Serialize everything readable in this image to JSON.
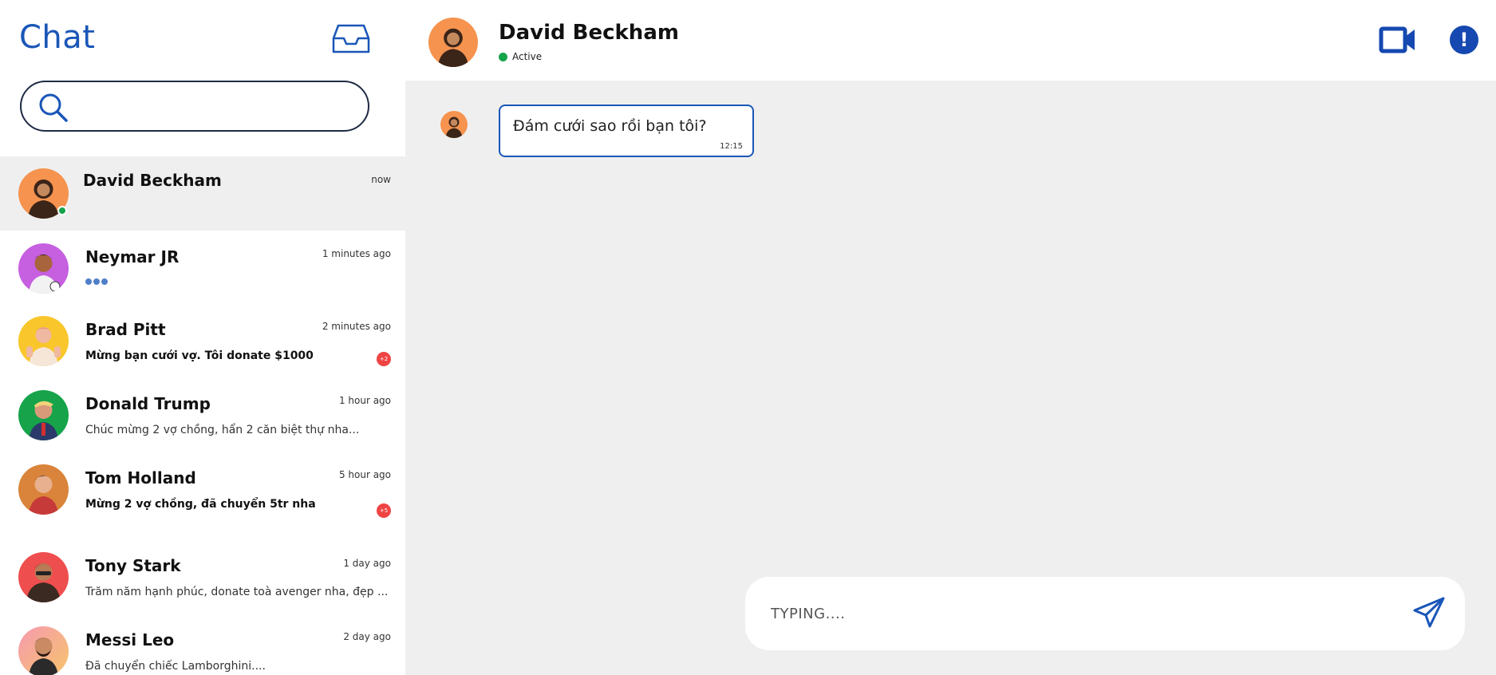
{
  "sidebar": {
    "title": "Chat",
    "search": {
      "placeholder": "",
      "value": ""
    },
    "conversations": [
      {
        "name": "David Beckham",
        "time": "now",
        "preview": "",
        "active": true,
        "online": true,
        "avatar_color": "#f5934f"
      },
      {
        "name": "Neymar JR",
        "time": "1 minutes ago",
        "preview": "",
        "typing": true,
        "avatar_color": "#c65fe0"
      },
      {
        "name": "Brad Pitt",
        "time": "2 minutes ago",
        "preview": "Mừng bạn cưới vợ. Tôi donate $1000",
        "preview_bold": true,
        "badge": "+2",
        "avatar_color": "#f9c62b"
      },
      {
        "name": "Donald Trump",
        "time": "1 hour ago",
        "preview": "Chúc mừng 2 vợ chồng, hẩn 2 căn biệt thự nha...",
        "avatar_color": "#16a34a"
      },
      {
        "name": "Tom Holland",
        "time": "5 hour ago",
        "preview": "Mừng 2 vợ chồng, đã chuyển 5tr nha",
        "preview_bold": true,
        "badge": "+5",
        "avatar_color": "#d9843a"
      },
      {
        "name": "Tony Stark",
        "time": "1 day ago",
        "preview": "Trăm năm hạnh phúc, donate toà avenger nha, đẹp ...",
        "avatar_color": "#ef4e4e"
      },
      {
        "name": "Messi Leo",
        "time": "2 day ago",
        "preview": "Đã chuyển chiếc Lamborghini....",
        "avatar_color": "#f59ab0"
      }
    ]
  },
  "header": {
    "name": "David Beckham",
    "status": "Active"
  },
  "messages": [
    {
      "text": "Đám cưới sao rồi bạn tôi?",
      "time": "12:15",
      "from": "David Beckham"
    }
  ],
  "compose": {
    "placeholder": "TYPING...."
  },
  "colors": {
    "accent": "#1a56b8",
    "online": "#16a34a",
    "badge": "#ef4444",
    "chat_bg": "#efefef"
  },
  "icons": {
    "inbox": "inbox-tray-icon",
    "search": "search-icon",
    "video": "video-camera-icon",
    "info": "info-icon",
    "send": "send-icon"
  }
}
